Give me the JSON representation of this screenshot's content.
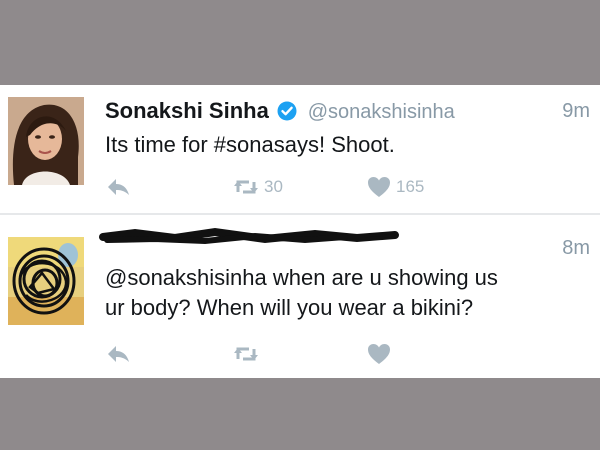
{
  "tweets": [
    {
      "display_name": "Sonakshi Sinha",
      "handle": "@sonakshisinha",
      "time": "9m",
      "text": "Its time for #sonasays! Shoot.",
      "retweets": "30",
      "likes": "165",
      "icons": [
        "reply-icon",
        "retweet-icon",
        "like-heart-icon",
        "verified-badge-icon"
      ]
    },
    {
      "time": "8m",
      "text_lines": [
        "@sonakshisinha when are u showing us",
        "ur body? When will you wear a bikini?"
      ],
      "icons": [
        "reply-icon",
        "retweet-icon",
        "like-heart-icon"
      ]
    }
  ],
  "colors": {
    "background": "#8f8a8c",
    "card": "#ffffff",
    "muted": "#8899a6",
    "icon": "#aab8c2",
    "verified": "#1da1f2",
    "text": "#14171a"
  }
}
